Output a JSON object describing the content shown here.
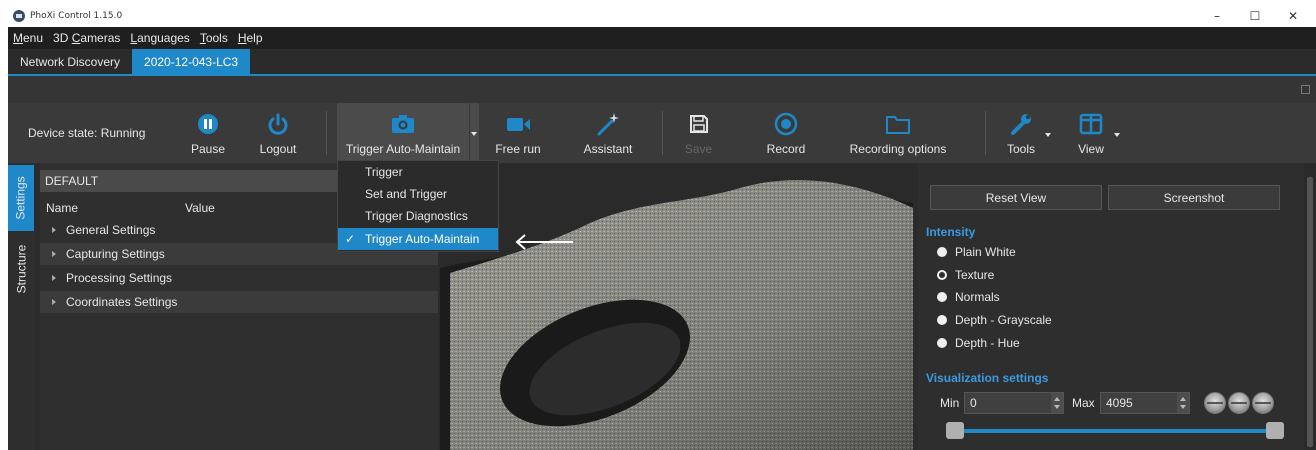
{
  "window": {
    "title": "PhoXi Control 1.15.0",
    "minimize": "–",
    "maximize": "☐",
    "close": "✕"
  },
  "menu": [
    {
      "label": "Menu",
      "accel": "M",
      "rest": "enu"
    },
    {
      "label": "3D Cameras",
      "accel": "",
      "rest": "3D Cameras"
    },
    {
      "label": "Languages",
      "accel": "L",
      "rest": "anguages"
    },
    {
      "label": "Tools",
      "accel": "T",
      "rest": "ools"
    },
    {
      "label": "Help",
      "accel": "H",
      "rest": "elp"
    }
  ],
  "tabs": {
    "discovery": "Network Discovery",
    "device": "2020-12-043-LC3"
  },
  "toolbar": {
    "device_state": "Device state: Running",
    "pause": "Pause",
    "logout": "Logout",
    "trigger": "Trigger Auto-Maintain",
    "free_run": "Free run",
    "assistant": "Assistant",
    "save": "Save",
    "record": "Record",
    "recording_options": "Recording options",
    "tools": "Tools",
    "view": "View"
  },
  "trigger_menu": {
    "items": [
      "Trigger",
      "Set and Trigger",
      "Trigger Diagnostics",
      "Trigger Auto-Maintain"
    ],
    "selected_index": 3,
    "check": "✓"
  },
  "side_tabs": {
    "settings": "Settings",
    "structure": "Structure"
  },
  "settings": {
    "profile": "DEFAULT",
    "col_name": "Name",
    "col_value": "Value",
    "groups": [
      "General Settings",
      "Capturing Settings",
      "Processing Settings",
      "Coordinates Settings"
    ]
  },
  "right_panel": {
    "reset_view": "Reset View",
    "screenshot": "Screenshot",
    "intensity_title": "Intensity",
    "intensity_options": [
      "Plain White",
      "Texture",
      "Normals",
      "Depth - Grayscale",
      "Depth - Hue"
    ],
    "intensity_selected": "Texture",
    "viz_title": "Visualization settings",
    "min_label": "Min",
    "min_value": "0",
    "max_label": "Max",
    "max_value": "4095",
    "slider_min_fraction": 0.0,
    "slider_max_fraction": 1.0
  },
  "colors": {
    "accent": "#1e88c8",
    "section_title": "#3b9ae0",
    "toolbar_bg": "#3a3a3a"
  }
}
